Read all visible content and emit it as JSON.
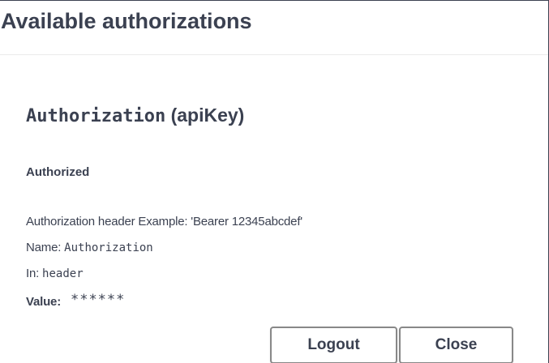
{
  "modal": {
    "title": "Available authorizations"
  },
  "auth": {
    "scheme_name": "Authorization",
    "scheme_type": "(apiKey)",
    "status": "Authorized",
    "description": "Authorization header Example: 'Bearer 12345abcdef'",
    "name_label": "Name:",
    "name_value": "Authorization",
    "in_label": "In:",
    "in_value": "header",
    "value_label": "Value:",
    "value_masked": "******"
  },
  "buttons": {
    "logout_label": "Logout",
    "close_label": "Close"
  },
  "colors": {
    "text": "#3b4151",
    "border": "#888888",
    "divider": "#ebebeb"
  }
}
